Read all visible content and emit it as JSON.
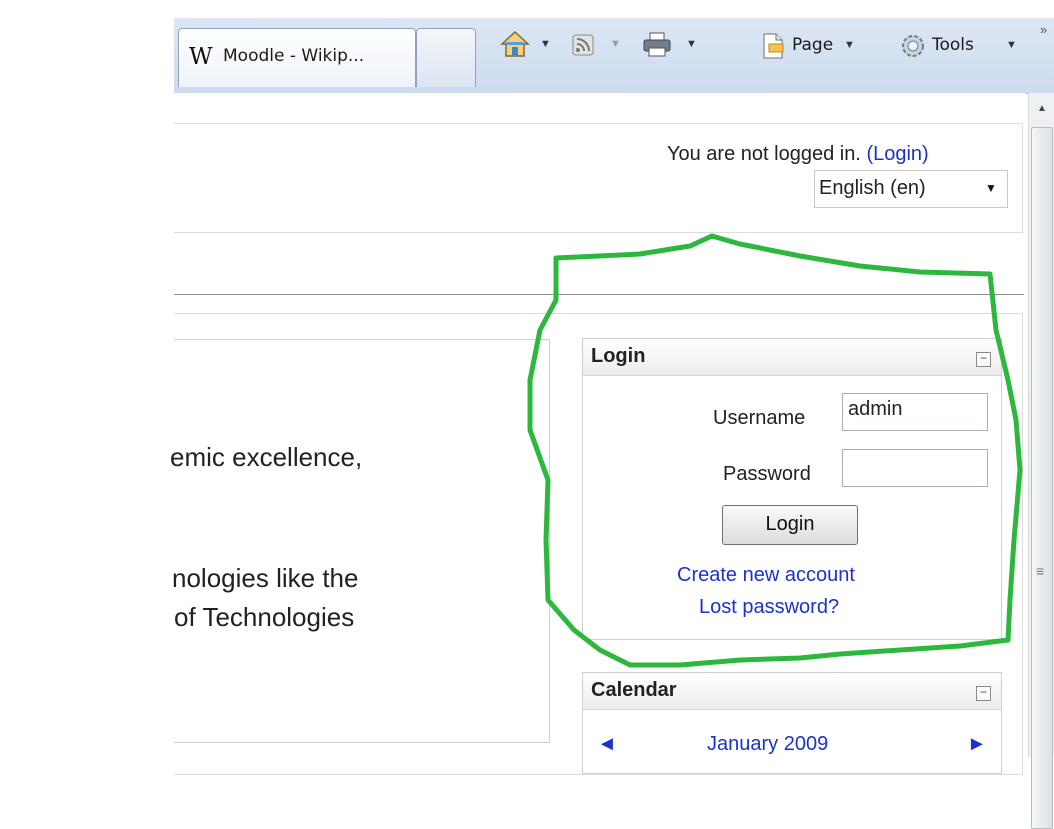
{
  "browser": {
    "tab_title": "Moodle - Wikip...",
    "wiki_glyph": "W",
    "overflow_chevron": "»",
    "toolbar": {
      "page_label": "Page",
      "tools_label": "Tools"
    }
  },
  "header": {
    "login_status": "You are not logged in.",
    "login_link_open": "(",
    "login_link": "Login",
    "login_link_close": ")",
    "language_selected": "English (en)"
  },
  "main": {
    "fragment_1": "emic excellence,",
    "fragment_2": "nologies like the",
    "fragment_3": "of Technologies"
  },
  "login_block": {
    "title": "Login",
    "username_label": "Username",
    "username_value": "admin",
    "password_label": "Password",
    "password_value": "",
    "login_button": "Login",
    "create_account": "Create new account",
    "lost_password": "Lost password?"
  },
  "calendar_block": {
    "title": "Calendar",
    "month": "January 2009",
    "prev": "◄",
    "next": "►"
  },
  "colors": {
    "annotation_circle": "#2db83d",
    "link": "#1a33c8"
  }
}
